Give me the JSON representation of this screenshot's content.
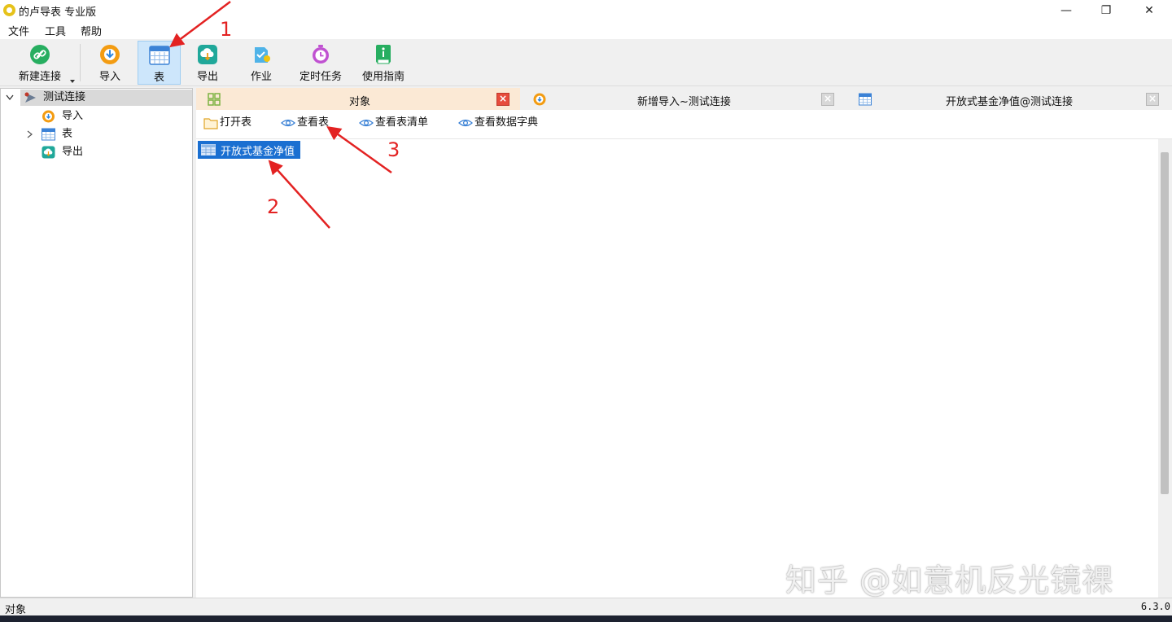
{
  "window": {
    "title": "的卢导表 专业版",
    "controls": {
      "minimize": "—",
      "maximize": "❐",
      "close": "✕"
    }
  },
  "menu": {
    "items": [
      "文件",
      "工具",
      "帮助"
    ]
  },
  "toolbar": {
    "new_connection": "新建连接",
    "import": "导入",
    "table": "表",
    "export": "导出",
    "job": "作业",
    "scheduled_task": "定时任务",
    "guide": "使用指南",
    "active_item": "表"
  },
  "tree": {
    "root": "测试连接",
    "children": [
      "导入",
      "表",
      "导出"
    ]
  },
  "tabs": [
    {
      "label": "对象",
      "active": true
    },
    {
      "label": "新增导入~测试连接",
      "active": false
    },
    {
      "label": "开放式基金净值@测试连接",
      "active": false
    }
  ],
  "object_toolbar": {
    "open_table": "打开表",
    "view_table": "查看表",
    "view_table_list": "查看表清单",
    "view_data_dictionary": "查看数据字典"
  },
  "objects": [
    {
      "name": "开放式基金净值",
      "selected": true
    }
  ],
  "status": {
    "left": "对象",
    "version": "6.3.0"
  },
  "watermark": "知乎 @如意机反光镜裸",
  "annotations": [
    "1",
    "2",
    "3"
  ],
  "colors": {
    "accent": "#1a6fd1",
    "active_tab": "#fbe9d5",
    "annotation": "#e32222",
    "close_active": "#e74c3c"
  }
}
